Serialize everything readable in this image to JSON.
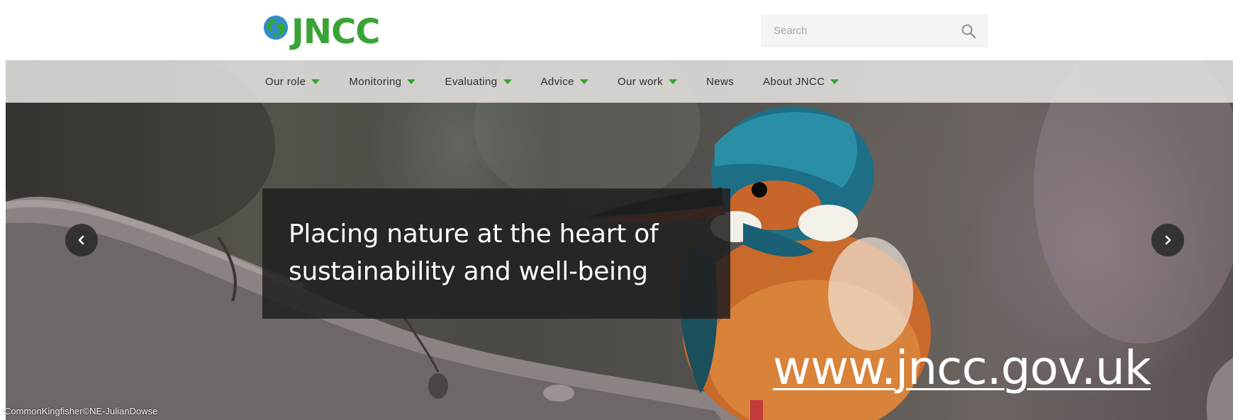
{
  "header": {
    "logo_text": "JNCC",
    "search_placeholder": "Search"
  },
  "nav": {
    "items": [
      {
        "label": "Our role",
        "has_dropdown": true
      },
      {
        "label": "Monitoring",
        "has_dropdown": true
      },
      {
        "label": "Evaluating",
        "has_dropdown": true
      },
      {
        "label": "Advice",
        "has_dropdown": true
      },
      {
        "label": "Our work",
        "has_dropdown": true
      },
      {
        "label": "News",
        "has_dropdown": false
      },
      {
        "label": "About JNCC",
        "has_dropdown": true
      }
    ]
  },
  "hero": {
    "caption_line1": "Placing nature at the heart of",
    "caption_line2": "sustainability and well-being",
    "url_text": "www.jncc.gov.uk",
    "image_credit": "CommonKingfisher©NE-JulianDowse"
  },
  "colors": {
    "brand_green": "#3aa335",
    "nav_text": "#2e2e2e",
    "caption_bg": "#21201f"
  },
  "icons": {
    "search": "search-icon",
    "prev": "chevron-left-icon",
    "next": "chevron-right-icon",
    "dropdown": "caret-down-icon"
  }
}
